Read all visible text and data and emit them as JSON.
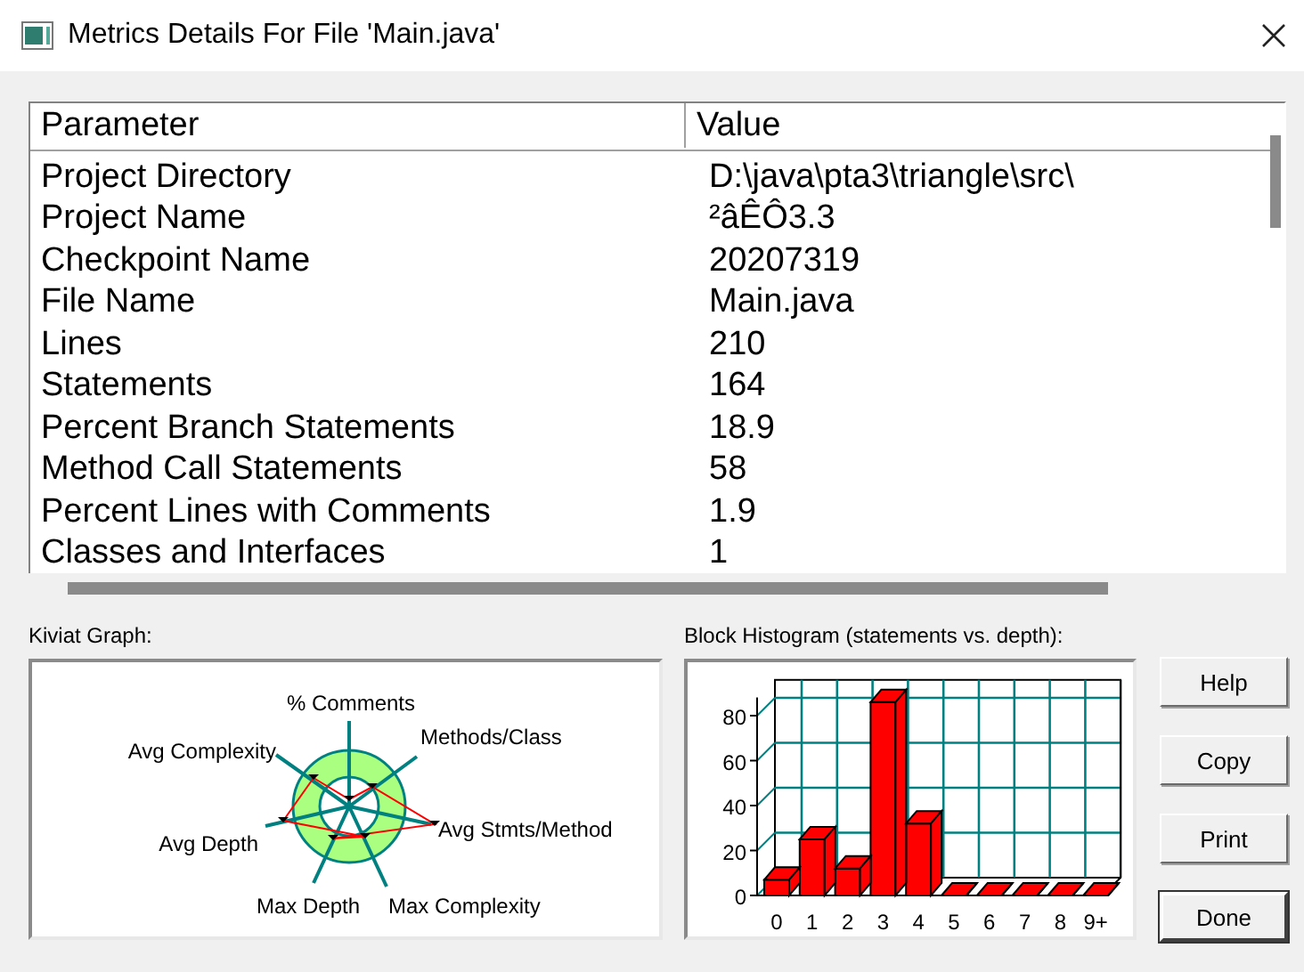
{
  "window": {
    "title": "Metrics Details For File 'Main.java'"
  },
  "table": {
    "columns": [
      "Parameter",
      "Value"
    ],
    "rows": [
      {
        "parameter": "Project Directory",
        "value": "D:\\java\\pta3\\triangle\\src\\"
      },
      {
        "parameter": "Project Name",
        "value": "²âÊÔ3.3"
      },
      {
        "parameter": "Checkpoint Name",
        "value": "20207319"
      },
      {
        "parameter": "File Name",
        "value": "Main.java"
      },
      {
        "parameter": "Lines",
        "value": "210"
      },
      {
        "parameter": "Statements",
        "value": "164"
      },
      {
        "parameter": "Percent Branch Statements",
        "value": "18.9"
      },
      {
        "parameter": "Method Call Statements",
        "value": "58"
      },
      {
        "parameter": "Percent Lines with Comments",
        "value": "1.9"
      },
      {
        "parameter": "Classes and Interfaces",
        "value": "1"
      }
    ]
  },
  "kiviat": {
    "label": "Kiviat Graph:",
    "axes": [
      "% Comments",
      "Methods/Class",
      "Avg Stmts/Method",
      "Max Depth",
      "Max Complexity",
      "Avg Depth",
      "Avg Complexity"
    ]
  },
  "histogram": {
    "label": "Block Histogram (statements vs. depth):",
    "chart_data": {
      "type": "bar",
      "categories": [
        "0",
        "1",
        "2",
        "3",
        "4",
        "5",
        "6",
        "7",
        "8",
        "9+"
      ],
      "values": [
        7,
        25,
        12,
        86,
        32,
        0,
        0,
        0,
        0,
        0
      ],
      "ylim": [
        0,
        88
      ],
      "yticks": [
        0,
        20,
        40,
        60,
        80
      ]
    }
  },
  "buttons": [
    "Help",
    "Copy",
    "Print",
    "Done"
  ]
}
